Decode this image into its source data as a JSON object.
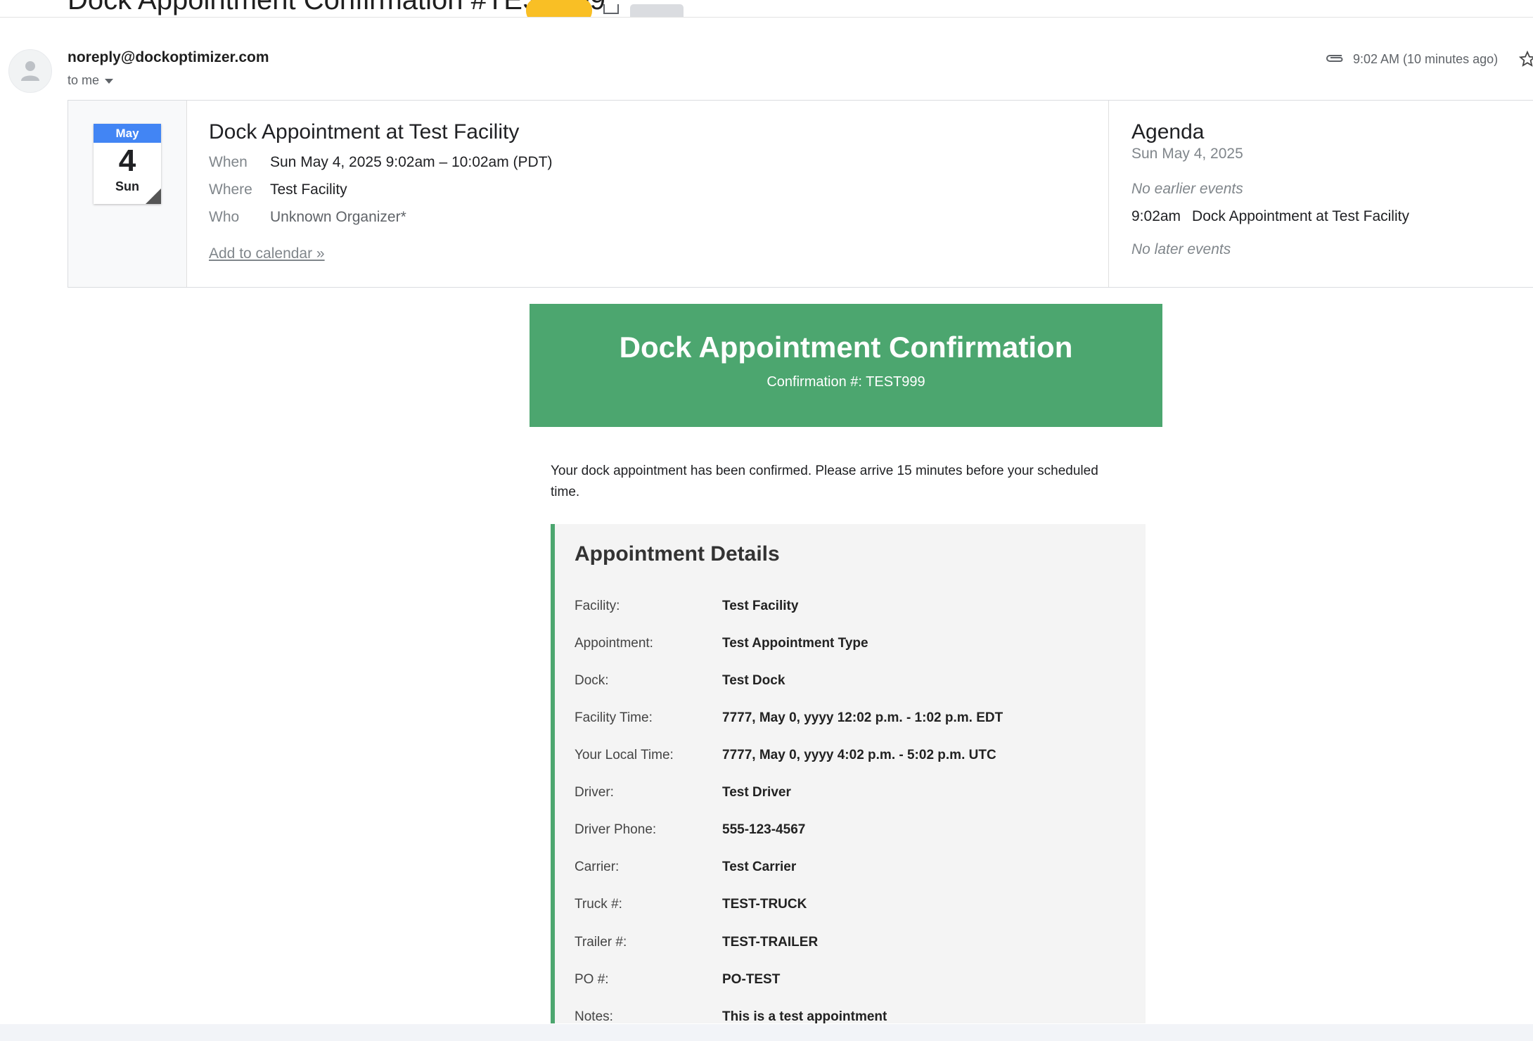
{
  "subject": "Dock Appointment Confirmation #TEST999",
  "sender": {
    "email": "noreply@dockoptimizer.com",
    "to": "to me",
    "timestamp": "9:02 AM (10 minutes ago)"
  },
  "invite": {
    "month": "May",
    "day": "4",
    "weekday": "Sun",
    "title": "Dock Appointment at Test Facility",
    "when_label": "When",
    "when_value": "Sun May 4, 2025 9:02am – 10:02am (PDT)",
    "where_label": "Where",
    "where_value": "Test Facility",
    "who_label": "Who",
    "who_value": "Unknown Organizer*",
    "add_link": "Add to calendar »"
  },
  "agenda": {
    "title": "Agenda",
    "date": "Sun May 4, 2025",
    "no_earlier": "No earlier events",
    "event_time": "9:02am",
    "event_title": "Dock Appointment at Test Facility",
    "no_later": "No later events"
  },
  "body": {
    "banner_title": "Dock Appointment Confirmation",
    "banner_sub": "Confirmation #: TEST999",
    "intro": "Your dock appointment has been confirmed. Please arrive 15 minutes before your scheduled time.",
    "details_title": "Appointment Details",
    "details": [
      {
        "label": "Facility:",
        "value": "Test Facility"
      },
      {
        "label": "Appointment:",
        "value": "Test Appointment Type"
      },
      {
        "label": "Dock:",
        "value": "Test Dock"
      },
      {
        "label": "Facility Time:",
        "value": "7777, May 0, yyyy 12:02 p.m. - 1:02 p.m. EDT"
      },
      {
        "label": "Your Local Time:",
        "value": "7777, May 0, yyyy 4:02 p.m. - 5:02 p.m. UTC"
      },
      {
        "label": "Driver:",
        "value": "Test Driver"
      },
      {
        "label": "Driver Phone:",
        "value": "555-123-4567"
      },
      {
        "label": "Carrier:",
        "value": "Test Carrier"
      },
      {
        "label": "Truck #:",
        "value": "TEST-TRUCK"
      },
      {
        "label": "Trailer #:",
        "value": "TEST-TRAILER"
      },
      {
        "label": "PO #:",
        "value": "PO-TEST"
      },
      {
        "label": "Notes:",
        "value": "This is a test appointment"
      }
    ]
  },
  "colors": {
    "accent_green": "#4ca66f",
    "calendar_blue": "#4285f4",
    "external_chip": "#f9bf25"
  }
}
